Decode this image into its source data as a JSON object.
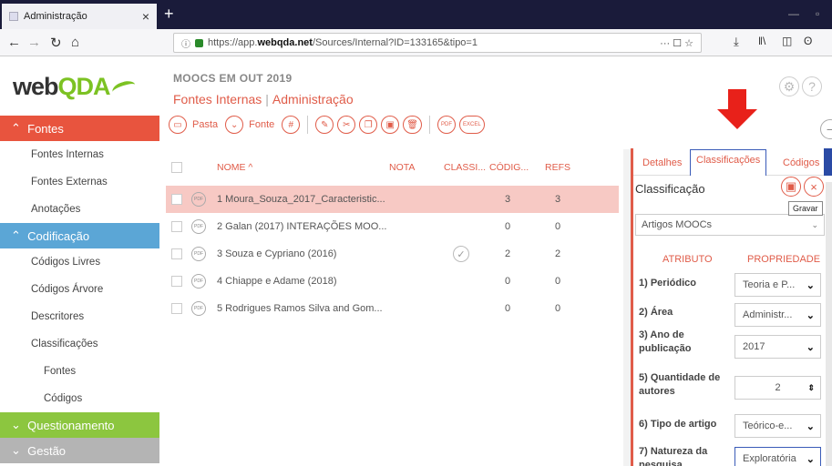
{
  "browser": {
    "tab_title": "Administração",
    "tab_close": "×",
    "new_tab": "+",
    "url_prefix": "https://app.",
    "url_host": "webqda.net",
    "url_path": "/Sources/Internal?ID=133165&tipo=1",
    "url_actions": "··· ☐ ☆"
  },
  "app": {
    "logo_main": "web",
    "logo_accent": "QDA",
    "project": "MOOCS EM OUT 2019",
    "crumb_1": "Fontes Internas",
    "crumb_2": "Administração",
    "toolbar": {
      "pasta": "Pasta",
      "fonte": "Fonte",
      "pdf": "PDF",
      "excel": "EXCEL"
    }
  },
  "sidebar": {
    "fontes_header": "Fontes",
    "fontes_items": [
      "Fontes Internas",
      "Fontes Externas",
      "Anotações"
    ],
    "codificacao_header": "Codificação",
    "codificacao_items": [
      "Códigos Livres",
      "Códigos Árvore",
      "Descritores",
      "Classificações"
    ],
    "class_sub": [
      "Fontes",
      "Códigos"
    ],
    "questionamento_header": "Questionamento",
    "gestao_header": "Gestão",
    "colors": {
      "fontes": "#e8543e",
      "codificacao": "#5ba6d6",
      "questionamento": "#8cc63f",
      "gestao": "#b4b4b4"
    }
  },
  "table": {
    "headers": {
      "nome": "NOME ^",
      "nota": "NOTA",
      "classi": "CLASSI...",
      "codig": "CÓDIG...",
      "refs": "REFS"
    },
    "rows": [
      {
        "name": "1 Moura_Souza_2017_Caracteristic...",
        "cod": "3",
        "refs": "3",
        "classified": false
      },
      {
        "name": "2 Galan (2017) INTERAÇÕES MOO...",
        "cod": "0",
        "refs": "0",
        "classified": false
      },
      {
        "name": "3 Souza e Cypriano (2016)",
        "cod": "2",
        "refs": "2",
        "classified": true
      },
      {
        "name": "4 Chiappe e Adame (2018)",
        "cod": "0",
        "refs": "0",
        "classified": false
      },
      {
        "name": "5 Rodrigues Ramos Silva and Gom...",
        "cod": "0",
        "refs": "0",
        "classified": false
      }
    ],
    "pdf_label": "PDF"
  },
  "panel": {
    "tabs": [
      "Detalhes",
      "Classificações",
      "Códigos"
    ],
    "title": "Classificação",
    "tooltip": "Gravar",
    "selected_class": "Artigos MOOCs",
    "attr_header": "ATRIBUTO",
    "prop_header": "PROPRIEDADE",
    "attributes": [
      {
        "label": "1) Periódico",
        "value": "Teoria e P..."
      },
      {
        "label": "2) Área",
        "value": "Administr..."
      },
      {
        "label": "3) Ano de publicação",
        "value": "2017"
      },
      {
        "label": "5) Quantidade de autores",
        "value": "2"
      },
      {
        "label": "6) Tipo de artigo",
        "value": "Teórico-e..."
      },
      {
        "label": "7) Natureza da pesquisa",
        "value": "Exploratória"
      }
    ]
  }
}
